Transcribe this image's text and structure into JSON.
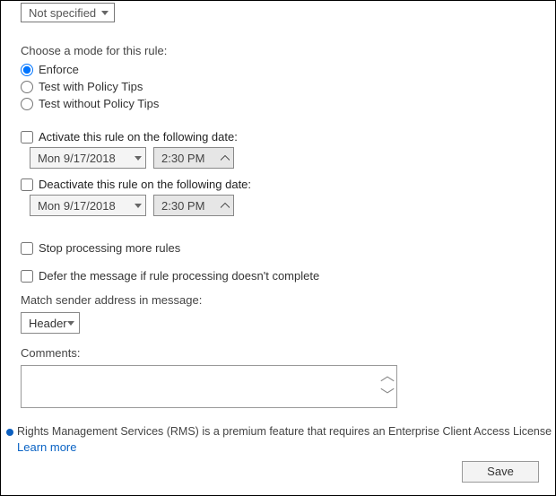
{
  "topSelect": {
    "value": "Not specified"
  },
  "modeSection": {
    "label": "Choose a mode for this rule:",
    "options": [
      {
        "label": "Enforce",
        "checked": true
      },
      {
        "label": "Test with Policy Tips",
        "checked": false
      },
      {
        "label": "Test without Policy Tips",
        "checked": false
      }
    ]
  },
  "activate": {
    "label": "Activate this rule on the following date:",
    "checked": false,
    "date": "Mon 9/17/2018",
    "time": "2:30 PM"
  },
  "deactivate": {
    "label": "Deactivate this rule on the following date:",
    "checked": false,
    "date": "Mon 9/17/2018",
    "time": "2:30 PM"
  },
  "stopProcessing": {
    "label": "Stop processing more rules",
    "checked": false
  },
  "deferMessage": {
    "label": "Defer the message if rule processing doesn't complete",
    "checked": false
  },
  "matchSender": {
    "label": "Match sender address in message:",
    "value": "Header"
  },
  "comments": {
    "label": "Comments:",
    "value": ""
  },
  "rmsNotice": "Rights Management Services (RMS) is a premium feature that requires an Enterprise Client Access License (CAL) for",
  "learnMore": "Learn more",
  "saveLabel": "Save"
}
